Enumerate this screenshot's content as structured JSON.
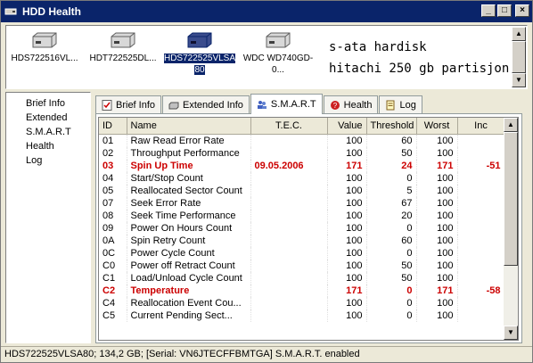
{
  "window": {
    "title": "HDD Health"
  },
  "drives": [
    {
      "label": "HDS722516VL...",
      "selected": false
    },
    {
      "label": "HDT722525DL...",
      "selected": false
    },
    {
      "label": "HDS722525VLSA 80",
      "selected": true
    },
    {
      "label": "WDC WD740GD-0...",
      "selected": false
    }
  ],
  "drive_description": {
    "line1": "s-ata hardisk",
    "line2": "hitachi 250 gb partisjon k"
  },
  "nav": {
    "items": [
      "Brief Info",
      "Extended",
      "S.M.A.R.T",
      "Health",
      "Log"
    ]
  },
  "tabs": [
    {
      "label": "Brief Info",
      "icon": "check-doc-icon"
    },
    {
      "label": "Extended Info",
      "icon": "drive-icon"
    },
    {
      "label": "S.M.A.R.T",
      "icon": "people-icon"
    },
    {
      "label": "Health",
      "icon": "health-icon"
    },
    {
      "label": "Log",
      "icon": "log-icon"
    }
  ],
  "smart": {
    "columns": [
      "ID",
      "Name",
      "T.E.C.",
      "Value",
      "Threshold",
      "Worst",
      "Inc"
    ],
    "rows": [
      {
        "id": "01",
        "name": "Raw Read Error Rate",
        "tec": "",
        "value": "100",
        "threshold": "60",
        "worst": "100",
        "inc": "",
        "alert": false
      },
      {
        "id": "02",
        "name": "Throughput Performance",
        "tec": "",
        "value": "100",
        "threshold": "50",
        "worst": "100",
        "inc": "",
        "alert": false
      },
      {
        "id": "03",
        "name": "Spin Up Time",
        "tec": "09.05.2006",
        "value": "171",
        "threshold": "24",
        "worst": "171",
        "inc": "-51",
        "alert": true
      },
      {
        "id": "04",
        "name": "Start/Stop Count",
        "tec": "",
        "value": "100",
        "threshold": "0",
        "worst": "100",
        "inc": "",
        "alert": false
      },
      {
        "id": "05",
        "name": "Reallocated Sector Count",
        "tec": "",
        "value": "100",
        "threshold": "5",
        "worst": "100",
        "inc": "",
        "alert": false
      },
      {
        "id": "07",
        "name": "Seek Error Rate",
        "tec": "",
        "value": "100",
        "threshold": "67",
        "worst": "100",
        "inc": "",
        "alert": false
      },
      {
        "id": "08",
        "name": "Seek Time Performance",
        "tec": "",
        "value": "100",
        "threshold": "20",
        "worst": "100",
        "inc": "",
        "alert": false
      },
      {
        "id": "09",
        "name": "Power On Hours Count",
        "tec": "",
        "value": "100",
        "threshold": "0",
        "worst": "100",
        "inc": "",
        "alert": false
      },
      {
        "id": "0A",
        "name": "Spin Retry Count",
        "tec": "",
        "value": "100",
        "threshold": "60",
        "worst": "100",
        "inc": "",
        "alert": false
      },
      {
        "id": "0C",
        "name": "Power Cycle Count",
        "tec": "",
        "value": "100",
        "threshold": "0",
        "worst": "100",
        "inc": "",
        "alert": false
      },
      {
        "id": "C0",
        "name": "Power off Retract Count",
        "tec": "",
        "value": "100",
        "threshold": "50",
        "worst": "100",
        "inc": "",
        "alert": false
      },
      {
        "id": "C1",
        "name": "Load/Unload Cycle Count",
        "tec": "",
        "value": "100",
        "threshold": "50",
        "worst": "100",
        "inc": "",
        "alert": false
      },
      {
        "id": "C2",
        "name": "Temperature",
        "tec": "",
        "value": "171",
        "threshold": "0",
        "worst": "171",
        "inc": "-58",
        "alert": true
      },
      {
        "id": "C4",
        "name": "Reallocation Event Cou...",
        "tec": "",
        "value": "100",
        "threshold": "0",
        "worst": "100",
        "inc": "",
        "alert": false
      },
      {
        "id": "C5",
        "name": "Current Pending Sect...",
        "tec": "",
        "value": "100",
        "threshold": "0",
        "worst": "100",
        "inc": "",
        "alert": false
      }
    ]
  },
  "status": {
    "text": "HDS722525VLSA80;  134,2 GB;  [Serial: VN6JTECFFBMTGA]  S.M.A.R.T. enabled"
  },
  "colors": {
    "titlebar": "#0a246a",
    "selection": "#0a246a",
    "alert": "#cc0000"
  }
}
